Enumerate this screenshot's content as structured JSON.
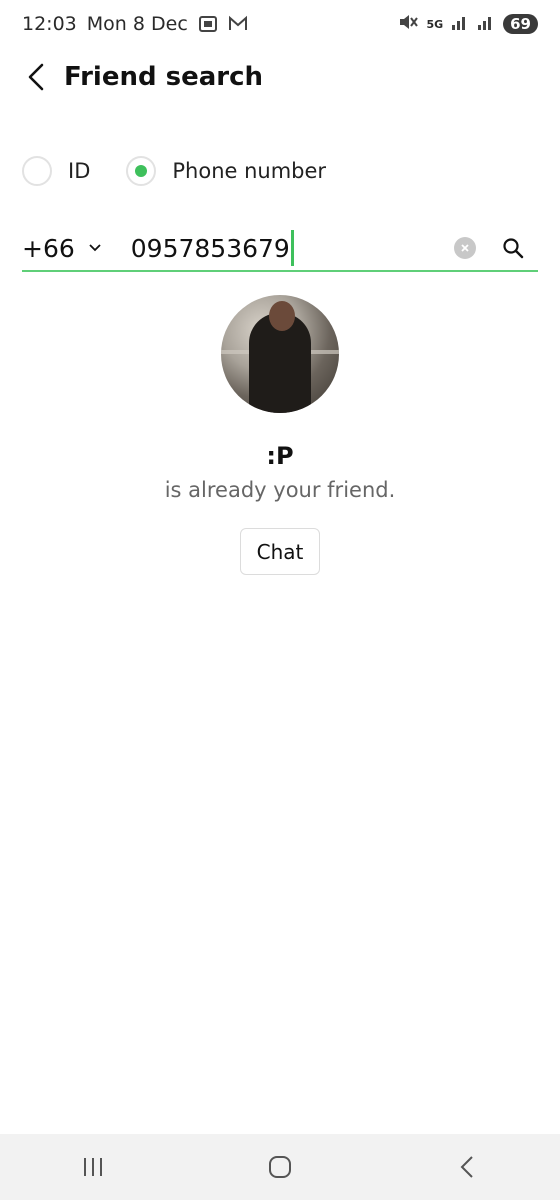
{
  "status_bar": {
    "time": "12:03",
    "date": "Mon 8 Dec",
    "network": "5G",
    "battery": "69"
  },
  "header": {
    "title": "Friend search",
    "back_icon": "chevron-left-icon"
  },
  "search_type": {
    "options": [
      {
        "label": "ID",
        "selected": false
      },
      {
        "label": "Phone number",
        "selected": true
      }
    ]
  },
  "search": {
    "country_code": "+66",
    "phone_value": "0957853679"
  },
  "result": {
    "name": ":P",
    "status": "is already your friend.",
    "chat_label": "Chat"
  },
  "colors": {
    "accent": "#3ec05c",
    "underline": "#5fcf78",
    "nav_bg": "#f2f2f2"
  }
}
